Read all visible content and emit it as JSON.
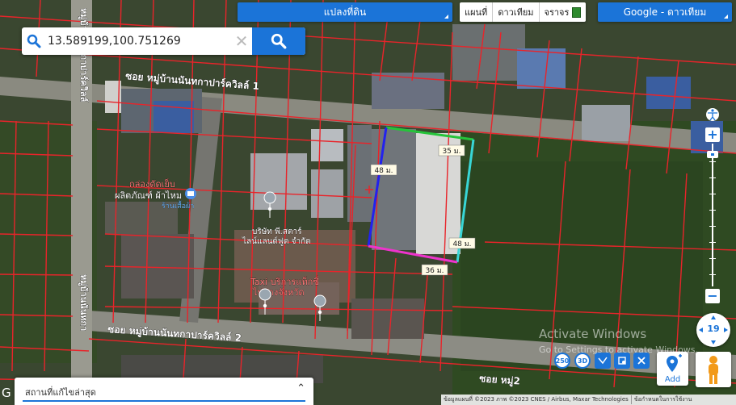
{
  "toolbar": {
    "layer_label": "แปลงที่ดิน",
    "maptypes": [
      "แผนที่",
      "ดาวเทียม",
      "จราจร"
    ],
    "basemap_label": "Google - ดาวเทียม"
  },
  "search": {
    "value": "13.589199,100.751269"
  },
  "roads": {
    "soi_north": "ซอย หมู่บ้านนันทกาปาร์ควิลล์ 1",
    "soi_south": "ซอย หมู่บ้านนันทกาปาร์ควิลล์ 2",
    "vertical_west_1": "หมู่บ้านนันทกาปาร์ควิลล์",
    "vertical_west_2": "หมู่บ้านนันทกา",
    "soi_bottom_right": "ซอย หมู่2"
  },
  "pois": [
    {
      "name": "กล่องดัดเย็บ",
      "line2": "ผลิตภัณฑ์ ผ้าไหม",
      "line3": "ร้านเสื้อผ้า"
    },
    {
      "name": "บริษัท พี.สตาร์",
      "line2": "ไลน์แลนด์ฟูด จำกัด"
    },
    {
      "name": "Taxi บริการแท็กซี่",
      "line2": "ไปต่างจังหวัด"
    }
  ],
  "measurements": [
    {
      "side": "north",
      "label": "35 ม.",
      "color": "#25c43a"
    },
    {
      "side": "west",
      "label": "48 ม.",
      "color": "#2222ee"
    },
    {
      "side": "east",
      "label": "48 ม.",
      "color": "#38d6d6"
    },
    {
      "side": "south",
      "label": "36 ม.",
      "color": "#ee33cc"
    }
  ],
  "tools": [
    "250",
    "3D",
    "",
    "",
    ""
  ],
  "add_label": "Add",
  "zoom": {
    "level": "19",
    "plus": "+",
    "minus": "−"
  },
  "recent": {
    "label": "สถานที่แก้ไขล่าสุด",
    "toggle": "⌃"
  },
  "watermark": {
    "line1": "Activate Windows",
    "line2": "Go to Settings to activate Windows."
  },
  "attribution": {
    "text": "ข้อมูลแผนที่ ©2023 ภาพ ©2023 CNES / Airbus, Maxar Technologies",
    "terms": "ข้อกำหนดในการใช้งาน"
  },
  "google_logo_letter": "G",
  "colors": {
    "accent": "#1b74d8",
    "parcel_line": "#e8242a",
    "north_side": "#25c43a",
    "west_side": "#2222ee",
    "east_side": "#38d6d6",
    "south_side": "#ee33cc"
  }
}
